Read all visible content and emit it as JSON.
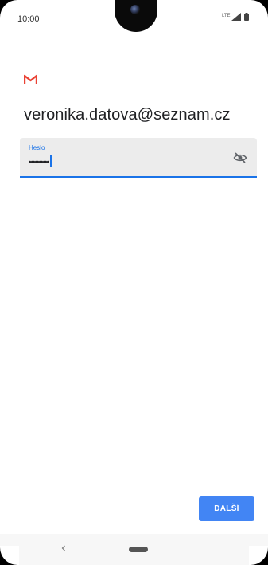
{
  "status_bar": {
    "time": "10:00",
    "network": "LTE",
    "icons": [
      "signal-icon",
      "battery-icon"
    ]
  },
  "account": {
    "logo": "gmail-logo",
    "email": "veronika.datova@seznam.cz"
  },
  "password_field": {
    "label": "Heslo",
    "value": "••••••••••",
    "visibility_icon": "eye-off-icon"
  },
  "actions": {
    "next_label": "DALŠÍ"
  },
  "colors": {
    "accent": "#1a73e8",
    "button": "#4285f4",
    "gmail_red": "#ea4335"
  }
}
